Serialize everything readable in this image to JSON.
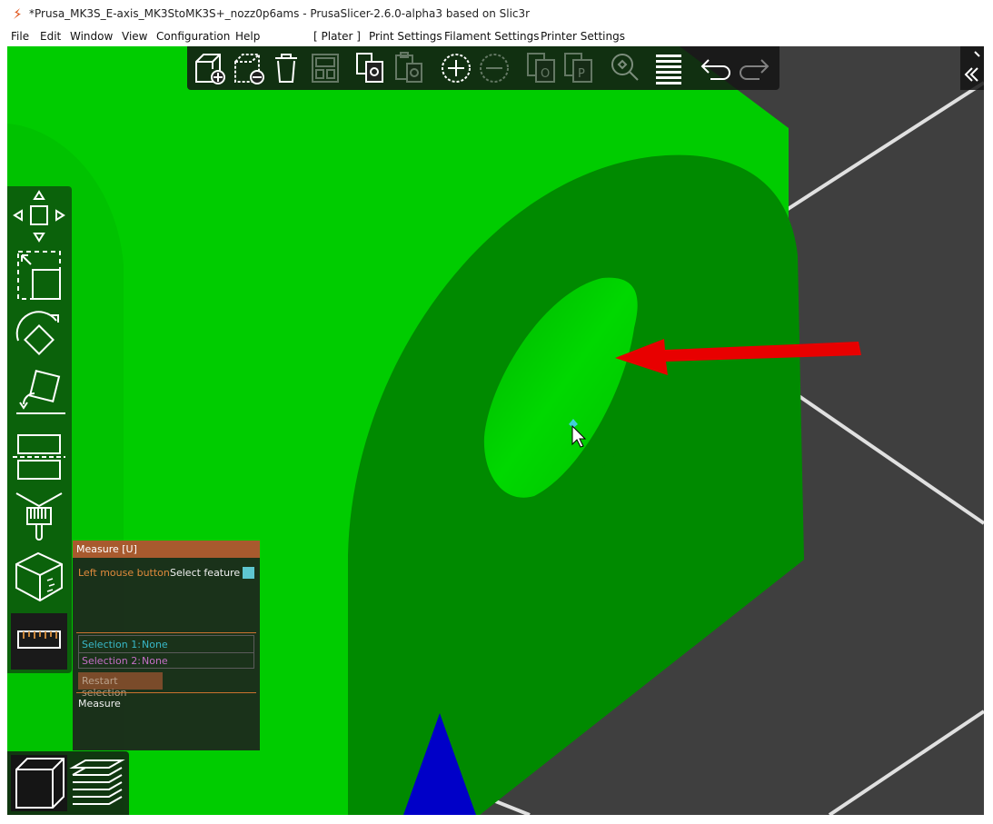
{
  "window": {
    "title": "*Prusa_MK3S_E-axis_MK3StoMK3S+_nozz0p6ams - PrusaSlicer-2.6.0-alpha3 based on Slic3r"
  },
  "menubar": {
    "items": [
      {
        "label": "File"
      },
      {
        "label": "Edit"
      },
      {
        "label": "Window"
      },
      {
        "label": "View"
      },
      {
        "label": "Configuration"
      },
      {
        "label": "Help"
      },
      {
        "label": "[ Plater ]"
      },
      {
        "label": "Print Settings"
      },
      {
        "label": "Filament Settings"
      },
      {
        "label": "Printer Settings"
      }
    ]
  },
  "top_toolbar": {
    "tools": [
      {
        "icon": "add-object-icon"
      },
      {
        "icon": "delete-object-icon"
      },
      {
        "icon": "delete-all-icon"
      },
      {
        "icon": "arrange-icon"
      },
      {
        "icon": "copy-icon"
      },
      {
        "icon": "paste-icon"
      },
      {
        "icon": "add-instance-icon"
      },
      {
        "icon": "remove-instance-icon"
      },
      {
        "icon": "split-objects-icon"
      },
      {
        "icon": "split-parts-icon"
      },
      {
        "icon": "search-icon"
      },
      {
        "icon": "layers-editing-icon"
      },
      {
        "icon": "undo-icon"
      },
      {
        "icon": "redo-icon"
      }
    ]
  },
  "left_toolbar": {
    "tools": [
      {
        "icon": "move-icon"
      },
      {
        "icon": "scale-icon"
      },
      {
        "icon": "rotate-icon"
      },
      {
        "icon": "place-on-face-icon"
      },
      {
        "icon": "cut-icon"
      },
      {
        "icon": "paint-supports-icon"
      },
      {
        "icon": "seam-painting-icon"
      },
      {
        "icon": "measure-icon",
        "active": true
      }
    ]
  },
  "view_toolbar": {
    "tools": [
      {
        "icon": "3d-view-icon",
        "active": true
      },
      {
        "icon": "preview-layers-icon"
      }
    ]
  },
  "measure_panel": {
    "title": "Measure [U]",
    "hint_key": "Left mouse button",
    "hint_action": "Select feature",
    "selection1_label": "Selection 1:",
    "selection1_value": "None",
    "selection2_label": "Selection 2:",
    "selection2_value": "None",
    "restart_label": "Restart selection",
    "measure_label": "Measure"
  },
  "colors": {
    "canvas_background": "#3f3f3f",
    "model_green": "#00cc00",
    "model_dark_green": "#008a00",
    "annotation_arrow": "#e80000",
    "cyan_selection": "#38b8c8",
    "magenta_selection": "#c46fc6",
    "panel_header": "#a85a2e",
    "axis_blue": "#0000c8"
  }
}
